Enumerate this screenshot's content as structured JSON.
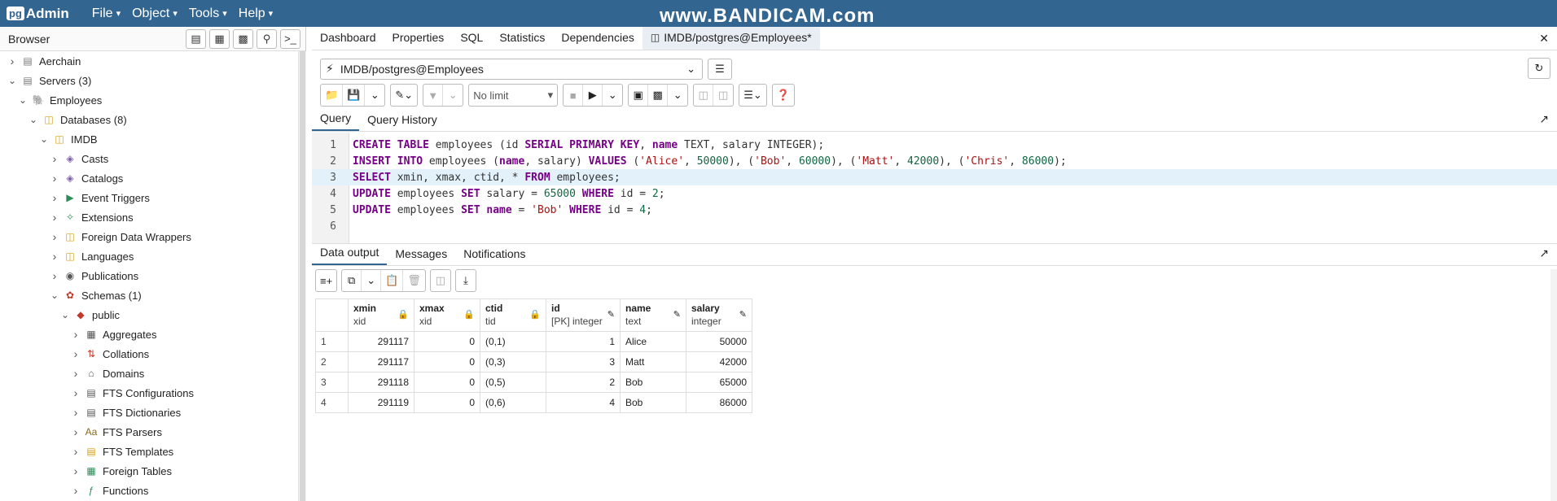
{
  "app": {
    "logo_prefix": "pg",
    "logo_name": "Admin",
    "menu": [
      {
        "label": "File"
      },
      {
        "label": "Object"
      },
      {
        "label": "Tools"
      },
      {
        "label": "Help"
      }
    ],
    "watermark": "www.BANDICAM.com"
  },
  "browser": {
    "title": "Browser",
    "tree": [
      {
        "label": "Aerchain",
        "depth": 0,
        "expanded": false,
        "icon": "server-group-icon"
      },
      {
        "label": "Servers (3)",
        "depth": 0,
        "expanded": true,
        "icon": "servers-icon"
      },
      {
        "label": "Employees",
        "depth": 1,
        "expanded": true,
        "icon": "elephant-icon"
      },
      {
        "label": "Databases (8)",
        "depth": 2,
        "expanded": true,
        "icon": "databases-icon"
      },
      {
        "label": "IMDB",
        "depth": 3,
        "expanded": true,
        "icon": "database-icon"
      },
      {
        "label": "Casts",
        "depth": 4,
        "expanded": false,
        "icon": "casts-icon"
      },
      {
        "label": "Catalogs",
        "depth": 4,
        "expanded": false,
        "icon": "catalogs-icon"
      },
      {
        "label": "Event Triggers",
        "depth": 4,
        "expanded": false,
        "icon": "event-triggers-icon"
      },
      {
        "label": "Extensions",
        "depth": 4,
        "expanded": false,
        "icon": "extensions-icon"
      },
      {
        "label": "Foreign Data Wrappers",
        "depth": 4,
        "expanded": false,
        "icon": "fdw-icon"
      },
      {
        "label": "Languages",
        "depth": 4,
        "expanded": false,
        "icon": "languages-icon"
      },
      {
        "label": "Publications",
        "depth": 4,
        "expanded": false,
        "icon": "publications-icon"
      },
      {
        "label": "Schemas (1)",
        "depth": 4,
        "expanded": true,
        "icon": "schemas-icon"
      },
      {
        "label": "public",
        "depth": 5,
        "expanded": true,
        "icon": "schema-icon"
      },
      {
        "label": "Aggregates",
        "depth": 6,
        "expanded": false,
        "icon": "aggregates-icon"
      },
      {
        "label": "Collations",
        "depth": 6,
        "expanded": false,
        "icon": "collations-icon"
      },
      {
        "label": "Domains",
        "depth": 6,
        "expanded": false,
        "icon": "domains-icon"
      },
      {
        "label": "FTS Configurations",
        "depth": 6,
        "expanded": false,
        "icon": "fts-config-icon"
      },
      {
        "label": "FTS Dictionaries",
        "depth": 6,
        "expanded": false,
        "icon": "fts-dict-icon"
      },
      {
        "label": "FTS Parsers",
        "depth": 6,
        "expanded": false,
        "icon": "fts-parsers-icon"
      },
      {
        "label": "FTS Templates",
        "depth": 6,
        "expanded": false,
        "icon": "fts-templates-icon"
      },
      {
        "label": "Foreign Tables",
        "depth": 6,
        "expanded": false,
        "icon": "foreign-tables-icon"
      },
      {
        "label": "Functions",
        "depth": 6,
        "expanded": false,
        "icon": "functions-icon"
      }
    ]
  },
  "tabs": [
    {
      "label": "Dashboard"
    },
    {
      "label": "Properties"
    },
    {
      "label": "SQL"
    },
    {
      "label": "Statistics"
    },
    {
      "label": "Dependencies"
    },
    {
      "label": "IMDB/postgres@Employees*",
      "active": true
    }
  ],
  "query_tool": {
    "connection": "IMDB/postgres@Employees",
    "limit": "No limit",
    "subtabs": [
      {
        "label": "Query",
        "active": true
      },
      {
        "label": "Query History"
      }
    ],
    "line_numbers": [
      "1",
      "2",
      "3",
      "4",
      "5",
      "6"
    ],
    "highlighted_line": 3
  },
  "results": {
    "tabs": [
      {
        "label": "Data output",
        "active": true
      },
      {
        "label": "Messages"
      },
      {
        "label": "Notifications"
      }
    ],
    "columns": [
      {
        "name": "xmin",
        "type": "xid",
        "icon": "lock-icon"
      },
      {
        "name": "xmax",
        "type": "xid",
        "icon": "lock-icon"
      },
      {
        "name": "ctid",
        "type": "tid",
        "icon": "lock-icon"
      },
      {
        "name": "id",
        "type": "[PK] integer",
        "icon": "pencil-icon"
      },
      {
        "name": "name",
        "type": "text",
        "icon": "pencil-icon"
      },
      {
        "name": "salary",
        "type": "integer",
        "icon": "pencil-icon"
      }
    ],
    "rows": [
      {
        "n": "1",
        "xmin": "291117",
        "xmax": "0",
        "ctid": "(0,1)",
        "id": "1",
        "name": "Alice",
        "salary": "50000"
      },
      {
        "n": "2",
        "xmin": "291117",
        "xmax": "0",
        "ctid": "(0,3)",
        "id": "3",
        "name": "Matt",
        "salary": "42000"
      },
      {
        "n": "3",
        "xmin": "291118",
        "xmax": "0",
        "ctid": "(0,5)",
        "id": "2",
        "name": "Bob",
        "salary": "65000"
      },
      {
        "n": "4",
        "xmin": "291119",
        "xmax": "0",
        "ctid": "(0,6)",
        "id": "4",
        "name": "Bob",
        "salary": "86000"
      }
    ]
  },
  "colors": {
    "header": "#326690",
    "keyword": "#770088",
    "string": "#aa1111",
    "number": "#116644",
    "highlight_line": "#e3f1fb"
  }
}
